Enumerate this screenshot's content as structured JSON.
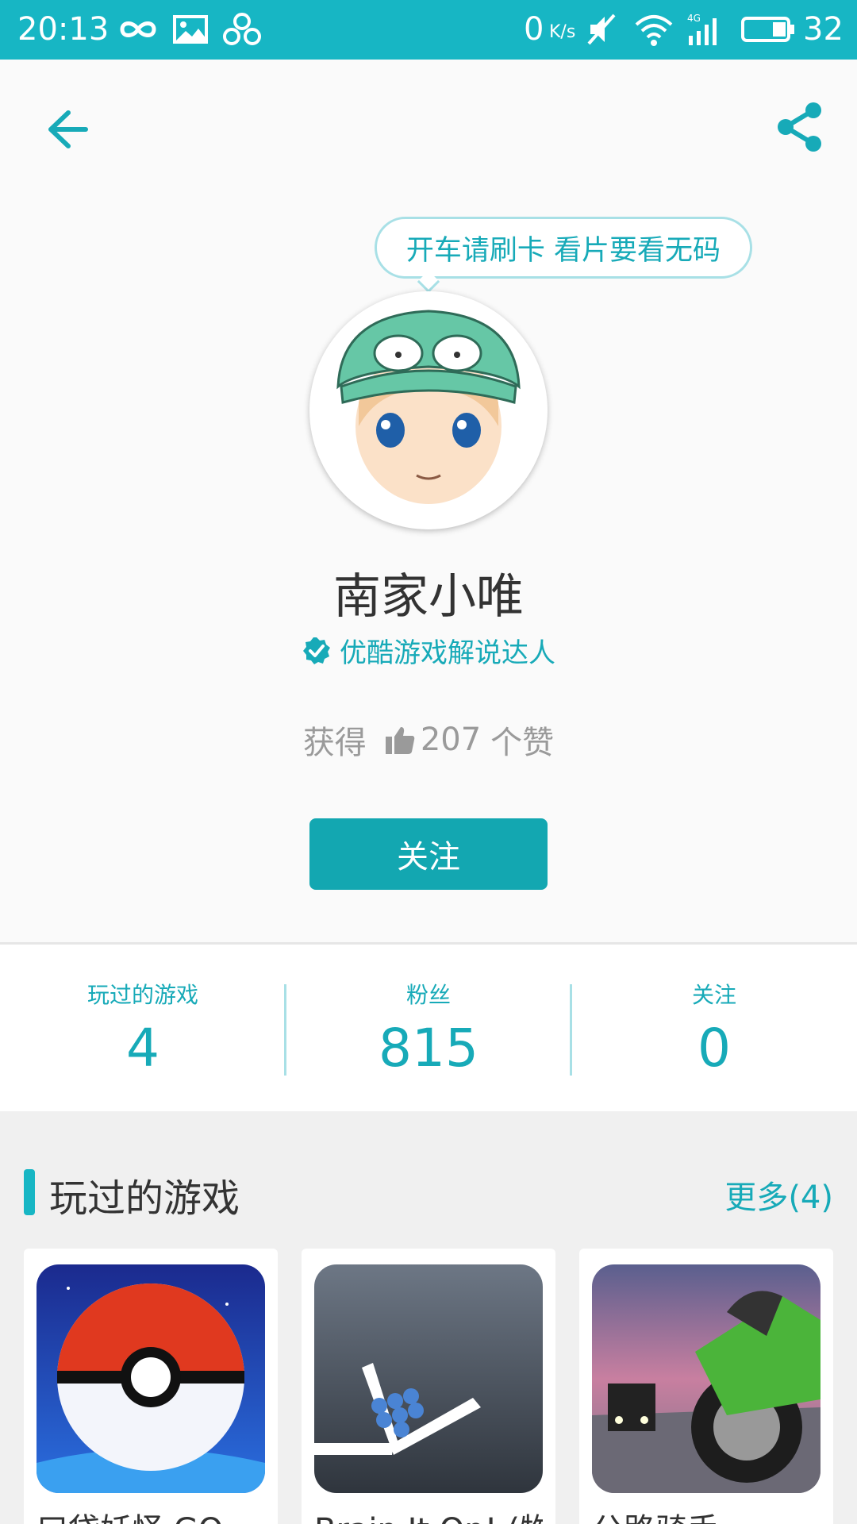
{
  "status_bar": {
    "time": "20:13",
    "net_speed": "0",
    "net_unit": "K/s",
    "battery": "32"
  },
  "profile": {
    "bubble_text": "开车请刷卡 看片要看无码",
    "name": "南家小唯",
    "badge": "优酷游戏解说达人",
    "likes_prefix": "获得",
    "likes_count": "207",
    "likes_suffix": "个赞",
    "follow_label": "关注"
  },
  "stats": [
    {
      "label": "玩过的游戏",
      "value": "4"
    },
    {
      "label": "粉丝",
      "value": "815"
    },
    {
      "label": "关注",
      "value": "0"
    }
  ],
  "games_section": {
    "title": "玩过的游戏",
    "more": "更多(4)",
    "games": [
      {
        "name": "口袋妖怪 GO"
      },
      {
        "name": "Brain It On! (物理"
      },
      {
        "name": "公路骑手"
      }
    ]
  },
  "colors": {
    "accent": "#17b6c4",
    "button": "#13a7b1"
  }
}
